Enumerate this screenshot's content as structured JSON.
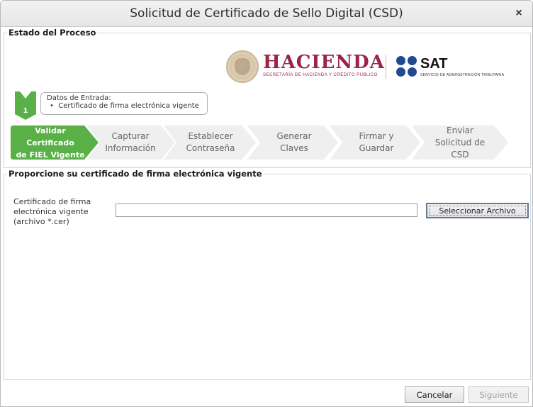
{
  "window": {
    "title": "Solicitud de Certificado de Sello Digital (CSD)",
    "close_icon": "×"
  },
  "process": {
    "group_title": "Estado del Proceso",
    "logos": {
      "hacienda_name": "HACIENDA",
      "hacienda_subtitle": "SECRETARÍA DE HACIENDA Y CRÉDITO PÚBLICO",
      "sat_name": "SAT",
      "sat_subtitle": "SERVICIO DE ADMINISTRACIÓN TRIBUTARIA",
      "hacienda_color": "#9d2449",
      "sat_color": "#1e4b8f"
    },
    "current_step_number": "1",
    "callout": {
      "title": "Datos de Entrada:",
      "items": [
        "Certificado de firma electrónica vigente"
      ]
    },
    "steps": [
      {
        "label": "Validar Certificado\nde FIEL Vigente",
        "active": true
      },
      {
        "label": "Capturar\nInformación",
        "active": false
      },
      {
        "label": "Establecer\nContraseña",
        "active": false
      },
      {
        "label": "Generar\nClaves",
        "active": false
      },
      {
        "label": "Firmar y\nGuardar",
        "active": false
      },
      {
        "label": "Enviar\nSolicitud de\nCSD",
        "active": false
      }
    ],
    "active_color": "#58b046",
    "inactive_color": "#efefef"
  },
  "form": {
    "group_title": "Proporcione su certificado de firma electrónica vigente",
    "file_label": "Certificado de firma electrónica vigente (archivo *.cer)",
    "file_value": "",
    "select_button": "Seleccionar Archivo"
  },
  "footer": {
    "cancel_label": "Cancelar",
    "next_label": "Siguiente",
    "next_enabled": false
  }
}
